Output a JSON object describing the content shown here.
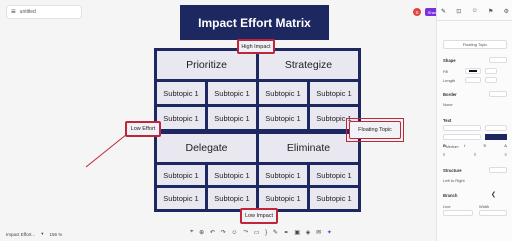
{
  "document": {
    "name": "untitled"
  },
  "title": "Impact Effort Matrix",
  "quadrants": {
    "top_left": "Prioritize",
    "top_right": "Strategize",
    "bottom_left": "Delegate",
    "bottom_right": "Eliminate"
  },
  "subtopic_label": "Subtopic 1",
  "callouts": {
    "top": "High Impact",
    "left": "Low Effort",
    "right": "Floating Topic",
    "bottom": "Low Impact"
  },
  "topbar": {
    "avatar_letter": "S",
    "share_label": "Share"
  },
  "panel": {
    "topic_chip": "Floating Topic",
    "shape_label": "Shape",
    "fill_label": "Fill",
    "length_label": "Length",
    "border_label": "Border",
    "border_value": "None",
    "text_label": "Text",
    "font_name": "NeueMontreal",
    "font_size": "14",
    "font_weight": "Medium",
    "structure_label": "Structure",
    "structure_value": "Left to Right",
    "branch_label": "Branch",
    "line_label": "Line",
    "width_label": "Width"
  },
  "bottom": {
    "map_name": "Impact Effort...",
    "zoom": "156 %"
  },
  "colors": {
    "navy": "#1d2760",
    "cell": "#e9e8f1",
    "accent_red": "#c0263a",
    "share_purple": "#7b2fe0"
  }
}
